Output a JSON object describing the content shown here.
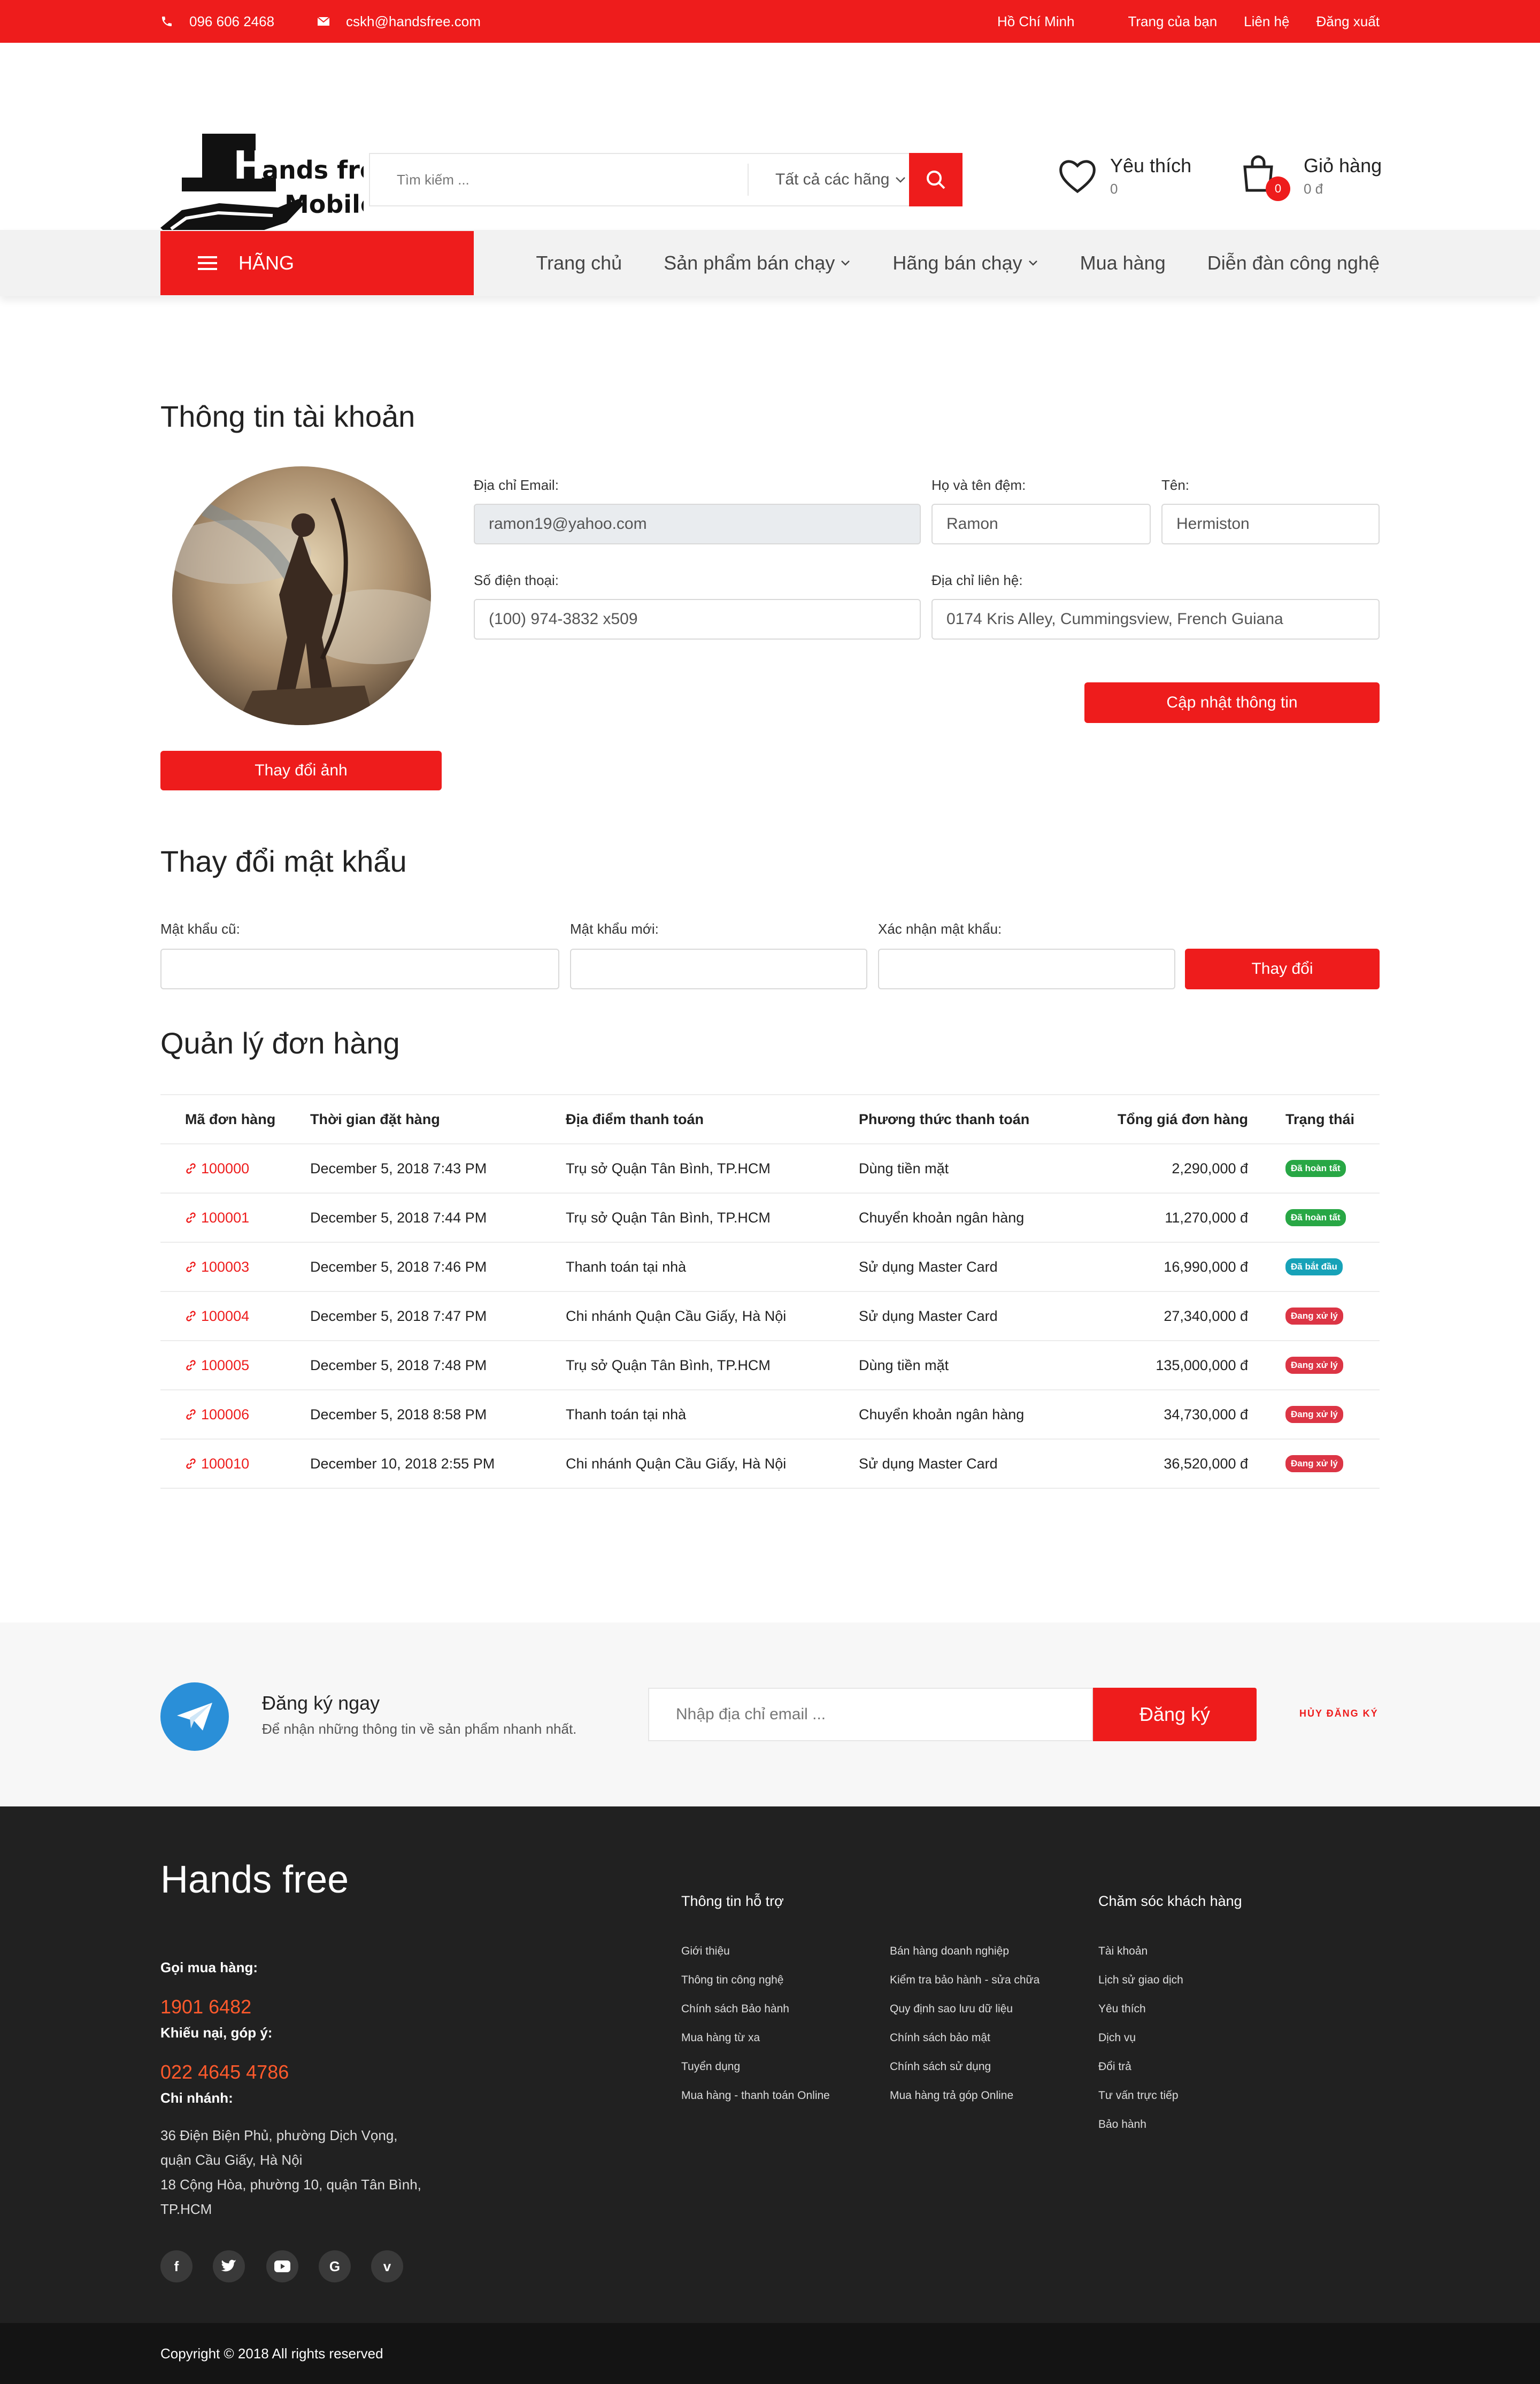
{
  "topbar": {
    "phone": "096 606 2468",
    "email": "cskh@handsfree.com",
    "city": "Hồ Chí Minh",
    "links": [
      "Trang của bạn",
      "Liên hệ",
      "Đăng xuất"
    ]
  },
  "header": {
    "logo_line1": "Hands free",
    "logo_line2": "Mobile",
    "search_placeholder": "Tìm kiếm ...",
    "category_select": "Tất cả các hãng",
    "wishlist_label": "Yêu thích",
    "wishlist_count": "0",
    "cart_label": "Giỏ hàng",
    "cart_total": "0 đ",
    "cart_badge": "0"
  },
  "nav": {
    "brand_button": "HÃNG",
    "items": [
      "Trang chủ",
      "Sản phẩm bán chạy",
      "Hãng bán chạy",
      "Mua hàng",
      "Diễn đàn công nghệ"
    ]
  },
  "account": {
    "title": "Thông tin tài khoản",
    "change_photo": "Thay đổi ảnh",
    "email_label": "Địa chỉ Email:",
    "email_value": "ramon19@yahoo.com",
    "middle_label": "Họ và tên đệm:",
    "middle_value": "Ramon",
    "first_label": "Tên:",
    "first_value": "Hermiston",
    "phone_label": "Số điện thoại:",
    "phone_value": "(100) 974-3832 x509",
    "address_label": "Địa chỉ liên hệ:",
    "address_value": "0174 Kris Alley, Cummingsview, French Guiana",
    "update_button": "Cập nhật thông tin"
  },
  "password": {
    "title": "Thay đổi mật khẩu",
    "old_label": "Mật khẩu cũ:",
    "new_label": "Mật khẩu mới:",
    "confirm_label": "Xác nhận mật khẩu:",
    "submit": "Thay đổi"
  },
  "orders": {
    "title": "Quản lý đơn hàng",
    "columns": [
      "Mã đơn hàng",
      "Thời gian đặt hàng",
      "Địa điểm thanh toán",
      "Phương thức thanh toán",
      "Tổng giá đơn hàng",
      "Trạng thái"
    ],
    "rows": [
      {
        "id": "100000",
        "time": "December 5, 2018 7:43 PM",
        "place": "Trụ sở Quận Tân Bình, TP.HCM",
        "method": "Dùng tiền mặt",
        "total": "2,290,000 đ",
        "status": "Đã hoàn tất",
        "color": "#28a745"
      },
      {
        "id": "100001",
        "time": "December 5, 2018 7:44 PM",
        "place": "Trụ sở Quận Tân Bình, TP.HCM",
        "method": "Chuyển khoản ngân hàng",
        "total": "11,270,000 đ",
        "status": "Đã hoàn tất",
        "color": "#28a745"
      },
      {
        "id": "100003",
        "time": "December 5, 2018 7:46 PM",
        "place": "Thanh toán tại nhà",
        "method": "Sử dụng Master Card",
        "total": "16,990,000 đ",
        "status": "Đã bắt đầu",
        "color": "#17a2b8"
      },
      {
        "id": "100004",
        "time": "December 5, 2018 7:47 PM",
        "place": "Chi nhánh Quận Cầu Giấy, Hà Nội",
        "method": "Sử dụng Master Card",
        "total": "27,340,000 đ",
        "status": "Đang xử lý",
        "color": "#dc3545"
      },
      {
        "id": "100005",
        "time": "December 5, 2018 7:48 PM",
        "place": "Trụ sở Quận Tân Bình, TP.HCM",
        "method": "Dùng tiền mặt",
        "total": "135,000,000 đ",
        "status": "Đang xử lý",
        "color": "#dc3545"
      },
      {
        "id": "100006",
        "time": "December 5, 2018 8:58 PM",
        "place": "Thanh toán tại nhà",
        "method": "Chuyển khoản ngân hàng",
        "total": "34,730,000 đ",
        "status": "Đang xử lý",
        "color": "#dc3545"
      },
      {
        "id": "100010",
        "time": "December 10, 2018 2:55 PM",
        "place": "Chi nhánh Quận Cầu Giấy, Hà Nội",
        "method": "Sử dụng Master Card",
        "total": "36,520,000 đ",
        "status": "Đang xử lý",
        "color": "#dc3545"
      }
    ]
  },
  "newsletter": {
    "title": "Đăng ký ngay",
    "subtitle": "Để nhận những thông tin về sản phẩm nhanh nhất.",
    "placeholder": "Nhập địa chỉ email ...",
    "button": "Đăng ký",
    "unsubscribe": "HỦY ĐĂNG KÝ"
  },
  "footer": {
    "brand": "Hands free",
    "call_label": "Gọi mua hàng:",
    "call_number": "1901 6482",
    "complaint_label": "Khiếu nại, góp ý:",
    "complaint_number": "022 4645 4786",
    "branch_label": "Chi nhánh:",
    "branch_lines": [
      "36 Điện Biện Phủ, phường Dịch Vọng,",
      "quận Cầu Giấy, Hà Nội",
      "18 Cộng Hòa, phường 10, quận Tân Bình,",
      "TP.HCM"
    ],
    "support_title": "Thông tin hỗ trợ",
    "support_col1": [
      "Giới thiệu",
      "Thông tin công nghệ",
      "Chính sách Bảo hành",
      "Mua hàng từ xa",
      "Tuyển dụng",
      "Mua hàng - thanh toán Online"
    ],
    "support_col2": [
      "Bán hàng doanh nghiệp",
      "Kiểm tra bảo hành - sửa chữa",
      "Quy định sao lưu dữ liệu",
      "Chính sách bảo mật",
      "Chính sách sử dụng",
      "Mua hàng trả góp Online"
    ],
    "care_title": "Chăm sóc khách hàng",
    "care_items": [
      "Tài khoản",
      "Lịch sử giao dịch",
      "Yêu thích",
      "Dịch vụ",
      "Đổi trả",
      "Tư vấn trực tiếp",
      "Bảo hành"
    ],
    "social": [
      "f",
      "t",
      "▶",
      "G",
      "v"
    ],
    "copyright": "Copyright © 2018 All rights reserved"
  },
  "colors": {
    "accent": "#ee1c1c",
    "footer_bg": "#212121"
  }
}
